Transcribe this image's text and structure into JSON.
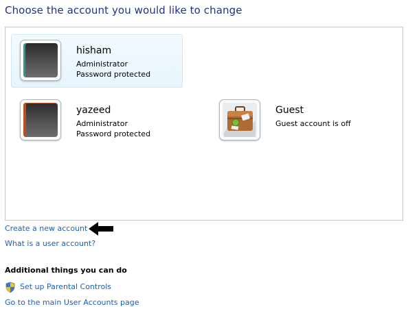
{
  "header": {
    "title": "Choose the account you would like to change"
  },
  "accounts": [
    {
      "name": "hisham",
      "line1": "Administrator",
      "line2": "Password protected",
      "selected": true,
      "avatar": "dark-blank-avatar"
    },
    {
      "name": "yazeed",
      "line1": "Administrator",
      "line2": "Password protected",
      "selected": false,
      "avatar": "dark-blank-avatar"
    },
    {
      "name": "Guest",
      "line1": "Guest account is off",
      "selected": false,
      "avatar": "briefcase-avatar"
    }
  ],
  "links": {
    "create_account": "Create a new account",
    "what_is_account": "What is a user account?"
  },
  "additional": {
    "heading": "Additional things you can do",
    "parental_controls": "Set up Parental Controls",
    "main_page": "Go to the main User Accounts page"
  },
  "icons": {
    "pointer_arrow": "left-arrow-icon",
    "parental_controls": "shield-icon"
  },
  "colors": {
    "title": "#1e3287",
    "link": "#1d5fb4",
    "selection_bg": "#e6f4fc",
    "selection_border": "#cfe8f7",
    "panel_border": "#c8c8c8"
  }
}
